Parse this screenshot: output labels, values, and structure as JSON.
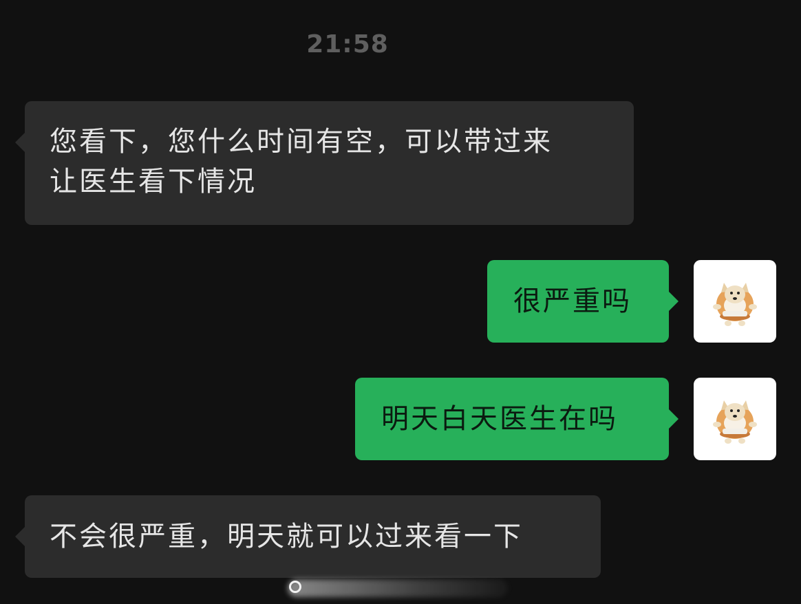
{
  "chat": {
    "timestamp": "21:58",
    "messages": [
      {
        "direction": "incoming",
        "lines": [
          "您看下，您什么时间有空，可以带过来",
          "让医生看下情况"
        ]
      },
      {
        "direction": "outgoing",
        "text": "很严重吗",
        "avatar_icon": "dog-avatar-icon"
      },
      {
        "direction": "outgoing",
        "text": "明天白天医生在吗",
        "avatar_icon": "dog-avatar-icon"
      },
      {
        "direction": "incoming",
        "lines": [
          "不会很严重，明天就可以过来看一下"
        ]
      }
    ]
  },
  "colors": {
    "background": "#111111",
    "incoming_bubble": "#2c2c2c",
    "outgoing_bubble": "#27b05a",
    "timestamp_text": "#5f5f5f"
  }
}
